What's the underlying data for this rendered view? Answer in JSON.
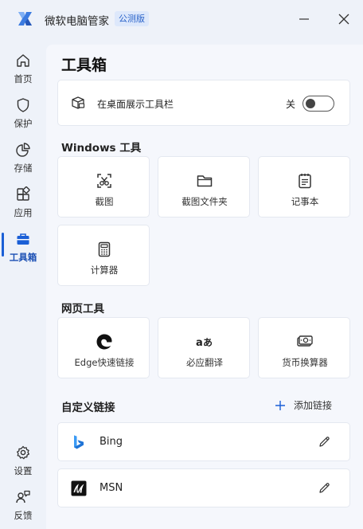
{
  "app": {
    "title": "微软电脑管家",
    "badge": "公测版"
  },
  "sidebar": {
    "items": [
      {
        "label": "首页",
        "icon": "home-icon"
      },
      {
        "label": "保护",
        "icon": "shield-icon"
      },
      {
        "label": "存储",
        "icon": "pie-chart-icon"
      },
      {
        "label": "应用",
        "icon": "apps-grid-icon"
      },
      {
        "label": "工具箱",
        "icon": "toolbox-icon",
        "active": true
      }
    ],
    "bottom_items": [
      {
        "label": "设置",
        "icon": "gear-icon"
      },
      {
        "label": "反馈",
        "icon": "feedback-icon"
      }
    ]
  },
  "main": {
    "title": "工具箱",
    "desktop_toggle": {
      "label": "在桌面展示工具栏",
      "state_label": "关",
      "on": false
    },
    "windows_tools": {
      "title": "Windows 工具",
      "tiles": [
        {
          "label": "截图",
          "icon": "screenshot-icon"
        },
        {
          "label": "截图文件夹",
          "icon": "folder-icon"
        },
        {
          "label": "记事本",
          "icon": "notepad-icon"
        },
        {
          "label": "计算器",
          "icon": "calculator-icon"
        }
      ]
    },
    "web_tools": {
      "title": "网页工具",
      "tiles": [
        {
          "label": "Edge快速链接",
          "icon": "edge-icon"
        },
        {
          "label": "必应翻译",
          "icon": "translate-icon"
        },
        {
          "label": "货币换算器",
          "icon": "currency-icon"
        }
      ]
    },
    "custom_links": {
      "title": "自定义链接",
      "add_label": "添加链接",
      "links": [
        {
          "label": "Bing",
          "icon": "bing-icon"
        },
        {
          "label": "MSN",
          "icon": "msn-icon"
        }
      ]
    }
  },
  "colors": {
    "accent": "#1a5fd6",
    "background": "#eef2f9",
    "content_background": "#f5f7fc",
    "card": "#ffffff"
  }
}
